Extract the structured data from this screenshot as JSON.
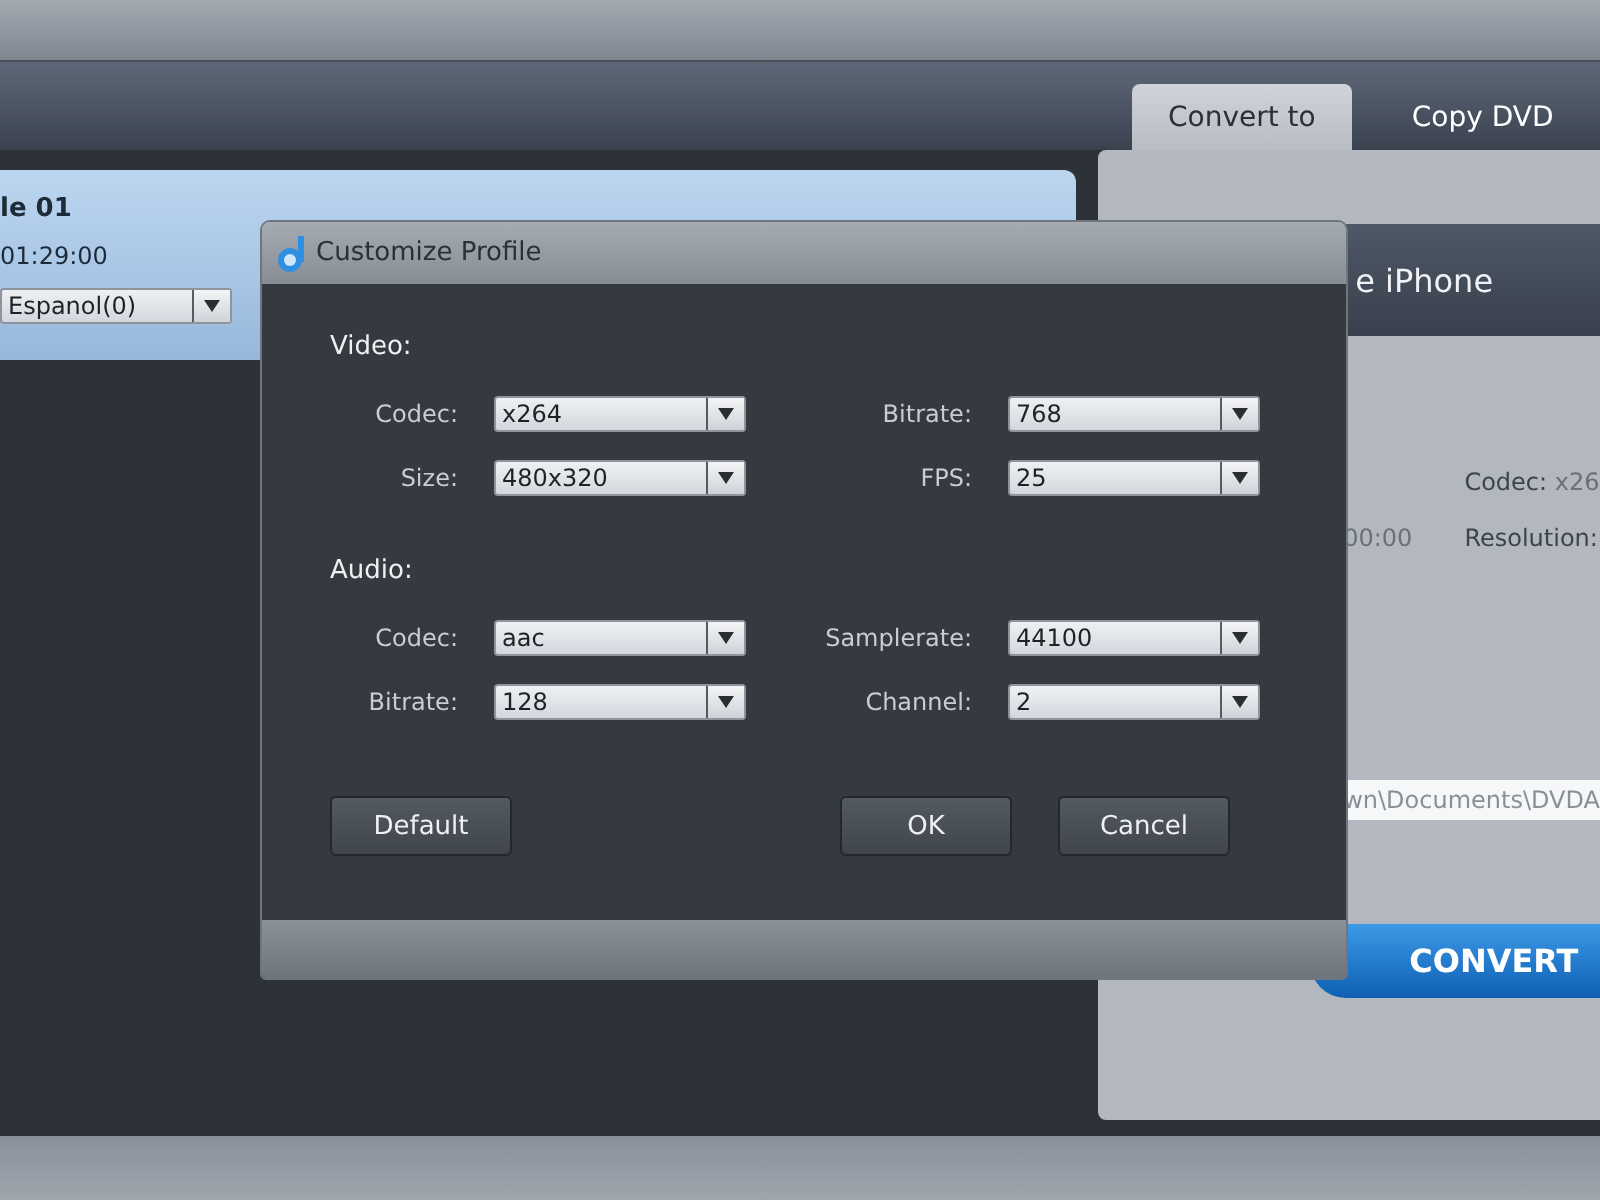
{
  "app": {
    "tabs": [
      {
        "label": "Convert to",
        "selected": true
      },
      {
        "label": "Copy DVD",
        "selected": false
      }
    ],
    "title_card": {
      "title": "le 01",
      "duration": "01:29:00",
      "audio_track": "Espanol(0)"
    },
    "profile_panel": {
      "heading": "e iPhone",
      "time": "00:00",
      "codec_label": "Codec:",
      "codec_value": "x26",
      "resolution_label": "Resolution:",
      "output_path": "wn\\Documents\\DVDA",
      "convert_button": "CONVERT"
    }
  },
  "dialog": {
    "title": "Customize Profile",
    "sections": [
      {
        "heading": "Video:",
        "fields": [
          {
            "label": "Codec:",
            "value": "x264"
          },
          {
            "label": "Bitrate:",
            "value": "768"
          },
          {
            "label": "Size:",
            "value": "480x320"
          },
          {
            "label": "FPS:",
            "value": "25"
          }
        ]
      },
      {
        "heading": "Audio:",
        "fields": [
          {
            "label": "Codec:",
            "value": "aac"
          },
          {
            "label": "Samplerate:",
            "value": "44100"
          },
          {
            "label": "Bitrate:",
            "value": "128"
          },
          {
            "label": "Channel:",
            "value": "2"
          }
        ]
      }
    ],
    "buttons": [
      {
        "label": "Default",
        "kind": "left"
      },
      {
        "label": "OK",
        "kind": "right"
      },
      {
        "label": "Cancel",
        "kind": "right"
      }
    ]
  }
}
